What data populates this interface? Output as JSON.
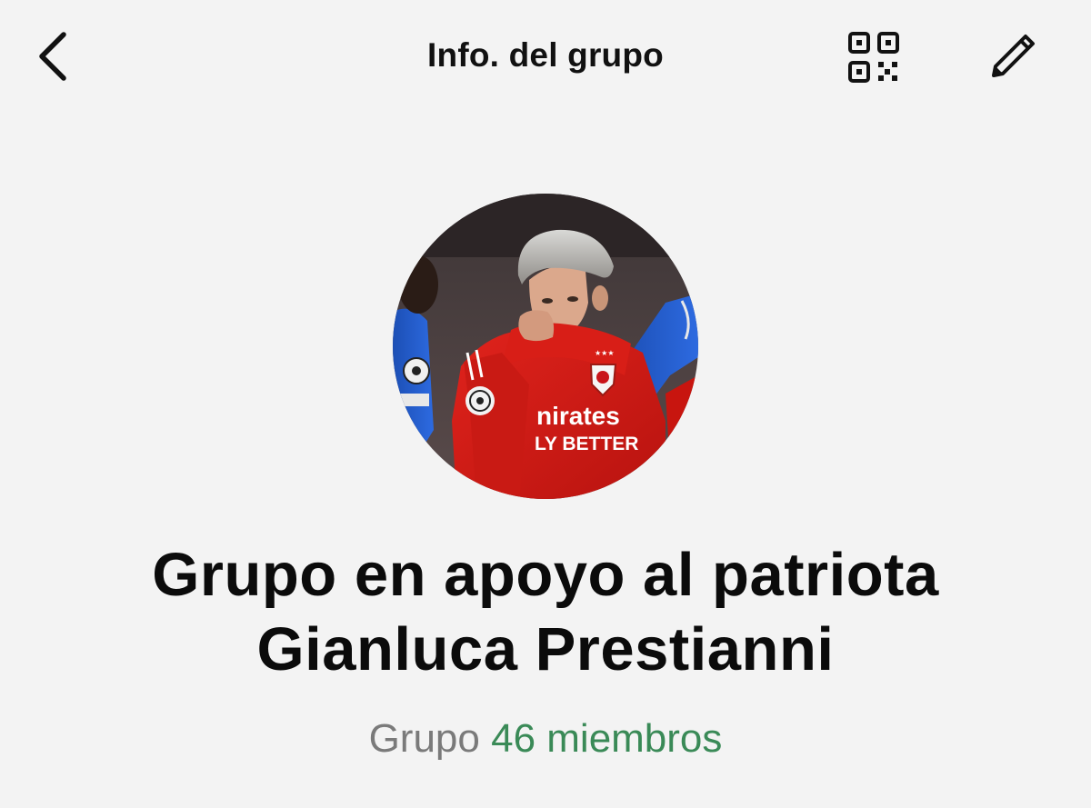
{
  "header": {
    "title": "Info. del grupo",
    "back_icon": "chevron-left-icon",
    "qr_icon": "qr-code-icon",
    "edit_icon": "pencil-icon"
  },
  "group": {
    "name_line1": "Grupo en apoyo al patriota",
    "name_line2": "Gianluca Prestianni",
    "type_label": "Grupo",
    "members_label": "46 miembros",
    "avatar_jersey_text1": "nirates",
    "avatar_jersey_text2": "LY BETTER"
  },
  "colors": {
    "background": "#f3f3f3",
    "text_primary": "#0b0b0b",
    "text_secondary": "#7a7a7a",
    "accent_green": "#3a8a57"
  }
}
